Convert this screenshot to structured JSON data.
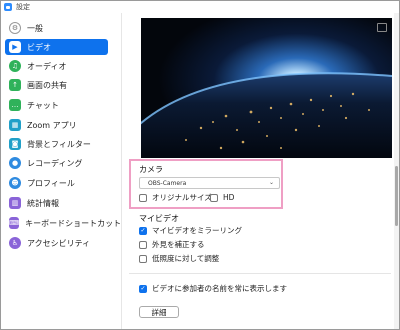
{
  "window": {
    "title": "設定"
  },
  "sidebar": {
    "items": [
      {
        "label": "一般",
        "icon": "gear-icon",
        "color": "#ffffff",
        "symbol": "⚙",
        "active": false
      },
      {
        "label": "ビデオ",
        "icon": "video-camera-icon",
        "color": "#ffffff",
        "symbol": "▶",
        "active": true
      },
      {
        "label": "オーディオ",
        "icon": "headphones-icon",
        "color": "#2fb25a",
        "symbol": "♫",
        "active": false
      },
      {
        "label": "画面の共有",
        "icon": "share-screen-icon",
        "color": "#2fb25a",
        "symbol": "↑",
        "active": false
      },
      {
        "label": "チャット",
        "icon": "chat-bubble-icon",
        "color": "#2fb25a",
        "symbol": "…",
        "active": false
      },
      {
        "label": "Zoom アプリ",
        "icon": "apps-icon",
        "color": "#21a0c8",
        "symbol": "▦",
        "active": false
      },
      {
        "label": "背景とフィルター",
        "icon": "background-person-icon",
        "color": "#21a0c8",
        "symbol": "◙",
        "active": false
      },
      {
        "label": "レコーディング",
        "icon": "record-icon",
        "color": "#2f8be0",
        "symbol": "●",
        "active": false
      },
      {
        "label": "プロフィール",
        "icon": "profile-icon",
        "color": "#2f8be0",
        "symbol": "☻",
        "active": false
      },
      {
        "label": "統計情報",
        "icon": "statistics-icon",
        "color": "#8a64d8",
        "symbol": "▥",
        "active": false
      },
      {
        "label": "キーボードショートカット",
        "icon": "keyboard-icon",
        "color": "#8a64d8",
        "symbol": "⌨",
        "active": false
      },
      {
        "label": "アクセシビリティ",
        "icon": "accessibility-icon",
        "color": "#8a64d8",
        "symbol": "♿",
        "active": false
      }
    ]
  },
  "camera": {
    "title": "カメラ",
    "selected": "OBS-Camera",
    "original_size_label": "オリジナルサイズ",
    "original_size_checked": false,
    "hd_label": "HD",
    "hd_checked": false,
    "highlight_color": "#ef9fc4"
  },
  "my_video": {
    "title": "マイビデオ",
    "mirror_label": "マイビデオをミラーリング",
    "mirror_checked": true,
    "touch_up_label": "外見を補正する",
    "touch_up_checked": false,
    "low_light_label": "低照度に対して調整",
    "low_light_checked": false
  },
  "names": {
    "always_show_label": "ビデオに参加者の名前を常に表示します",
    "always_show_checked": true
  },
  "details_button": "詳細",
  "accent_color": "#0e72ed"
}
